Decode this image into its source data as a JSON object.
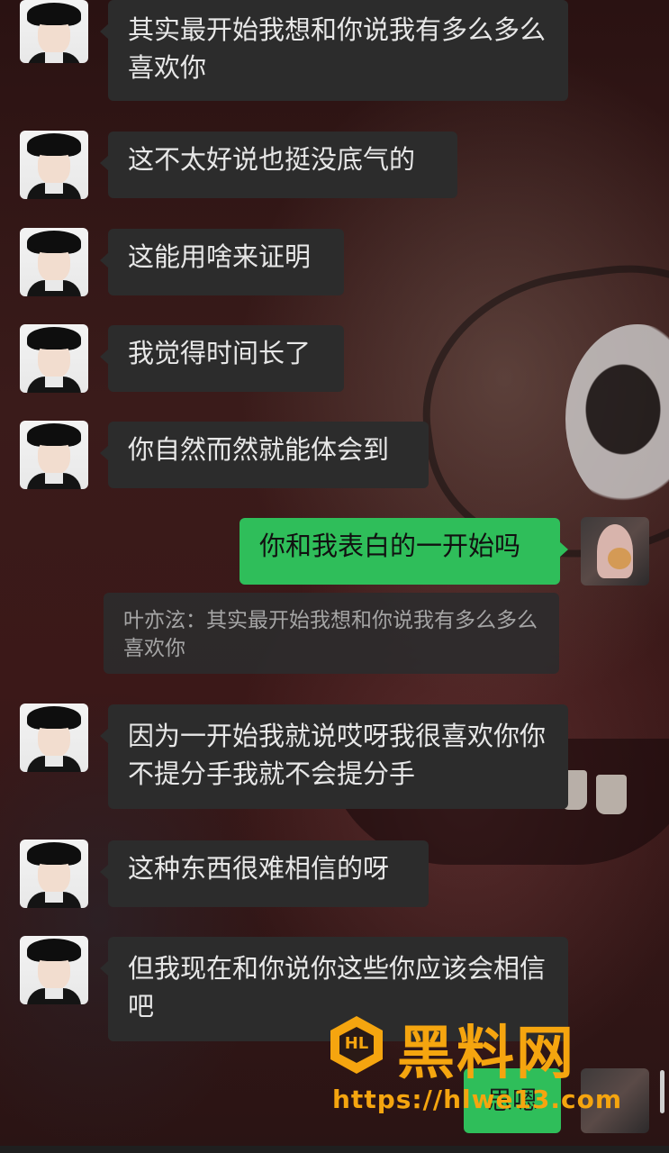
{
  "messages": [
    {
      "side": "left",
      "text": "其实最开始我想和你说我有多么多么喜欢你"
    },
    {
      "side": "left",
      "text": "这不太好说也挺没底气的"
    },
    {
      "side": "left",
      "text": "这能用啥来证明"
    },
    {
      "side": "left",
      "text": "我觉得时间长了"
    },
    {
      "side": "left",
      "text": "你自然而然就能体会到"
    },
    {
      "side": "right",
      "text": "你和我表白的一开始吗"
    },
    {
      "side": "left",
      "text": "因为一开始我就说哎呀我很喜欢你你不提分手我就不会提分手"
    },
    {
      "side": "left",
      "text": "这种东西很难相信的呀"
    },
    {
      "side": "left",
      "text": "但我现在和你说你这些你应该会相信吧"
    }
  ],
  "quote": {
    "text": "叶亦泫：其实最开始我想和你说我有多么多么喜欢你"
  },
  "bottom_bubble": {
    "text": "思嗯"
  },
  "watermark": {
    "logo_text": "HL",
    "title": "黑料网",
    "url": "https://hlwe13.com"
  },
  "icons": {
    "contact_avatar": "anime-boy-avatar",
    "my_avatar": "girl-with-dog-avatar"
  }
}
